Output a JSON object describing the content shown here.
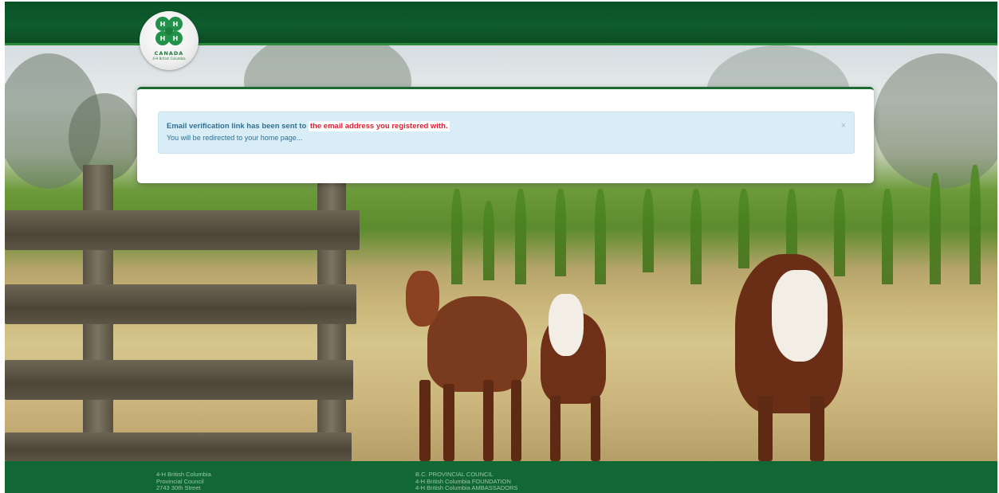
{
  "header": {
    "logo": {
      "icon": "4-h-clover-icon",
      "text_line1": "CANADA",
      "text_line2": "4-H British Columbia"
    }
  },
  "alert": {
    "message_prefix": "Email verification link has been sent to",
    "highlight": "the email address you registered with.",
    "message_line2": "You will be redirected to your home page...",
    "close_label": "×",
    "colors": {
      "background": "#d9edf7",
      "text": "#31708f",
      "highlight": "#e02033"
    }
  },
  "footer": {
    "address": [
      "4-H British Columbia",
      "Provincial Council",
      "2743 30th Street"
    ],
    "links": [
      "B.C. PROVINCIAL COUNCIL",
      "4-H British Columbia FOUNDATION",
      "4-H British Columbia AMBASSADORS"
    ]
  },
  "colors": {
    "header_green": "#0f5c2d",
    "footer_green": "#116834",
    "accent_green": "#2e8b3c"
  }
}
